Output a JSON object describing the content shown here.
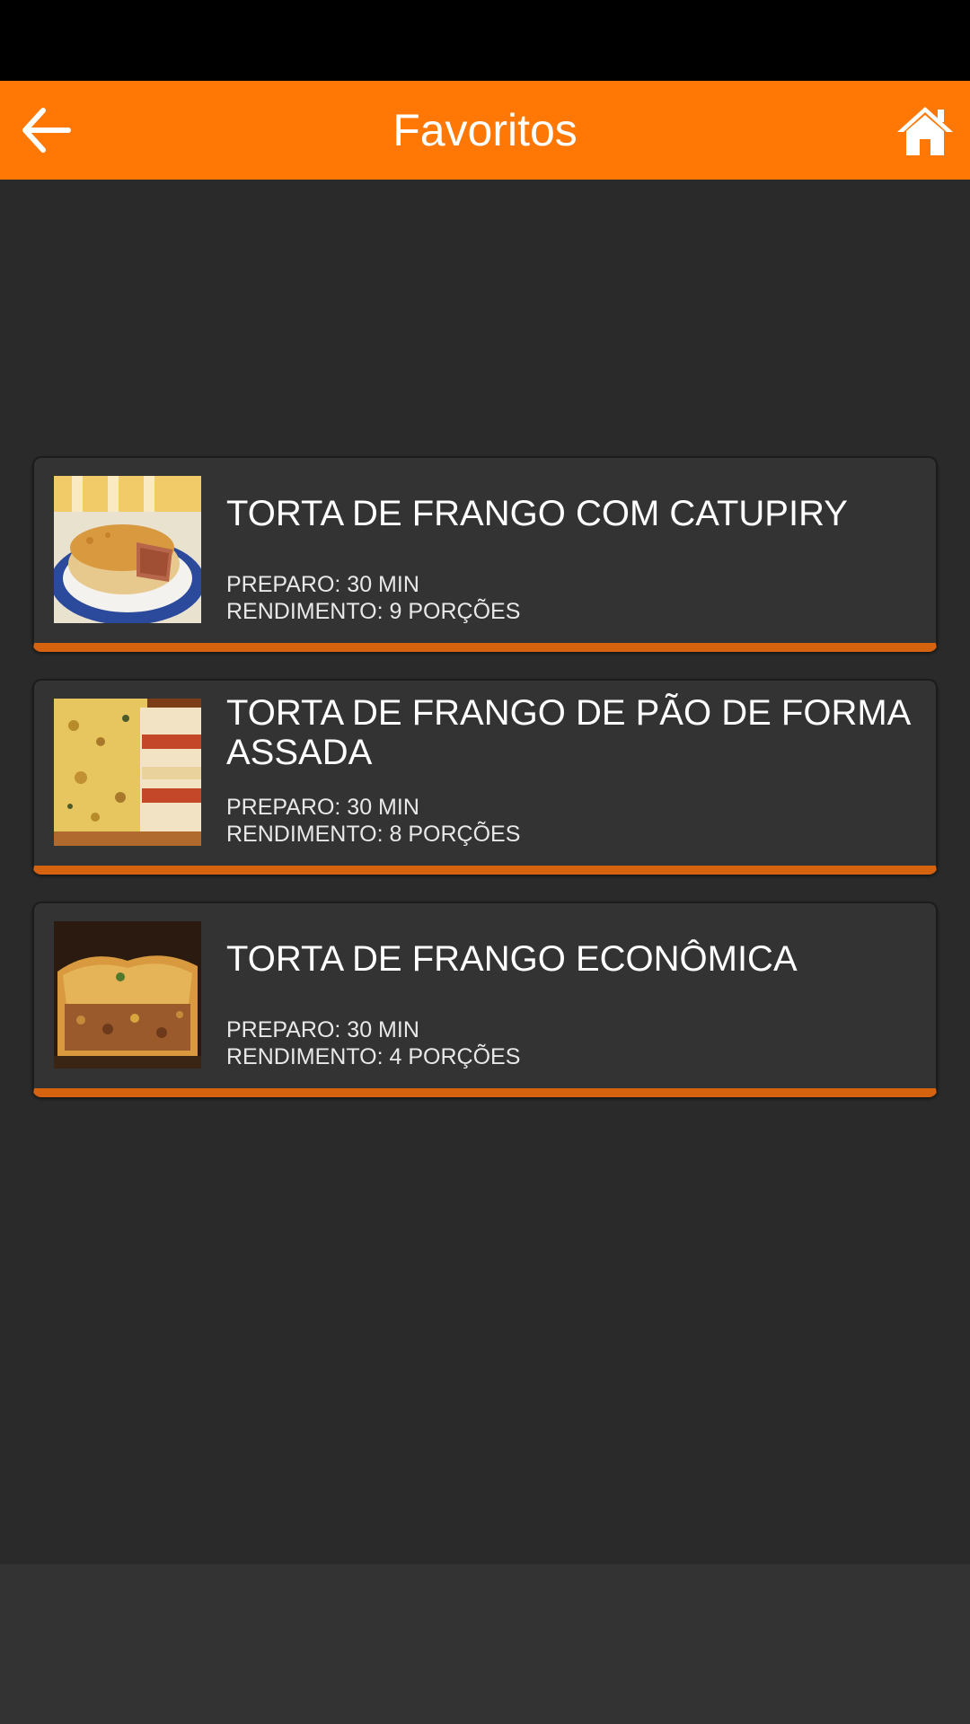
{
  "header": {
    "title": "Favoritos",
    "back_icon": "arrow-left-icon",
    "home_icon": "home-icon",
    "background_color": "#ff7805"
  },
  "recipes": [
    {
      "title": "TORTA DE FRANGO COM CATUPIRY",
      "preparo": "PREPARO: 30 MIN",
      "rendimento": "RENDIMENTO: 9 PORÇÕES"
    },
    {
      "title": "TORTA DE FRANGO DE PÃO DE FORMA ASSADA",
      "preparo": "PREPARO: 30 MIN",
      "rendimento": "RENDIMENTO: 8 PORÇÕES"
    },
    {
      "title": "TORTA DE FRANGO ECONÔMICA",
      "preparo": "PREPARO: 30 MIN",
      "rendimento": "RENDIMENTO: 4 PORÇÕES"
    }
  ],
  "colors": {
    "accent": "#d4620f",
    "card_background": "#333333",
    "page_background": "#2a2a2a"
  }
}
